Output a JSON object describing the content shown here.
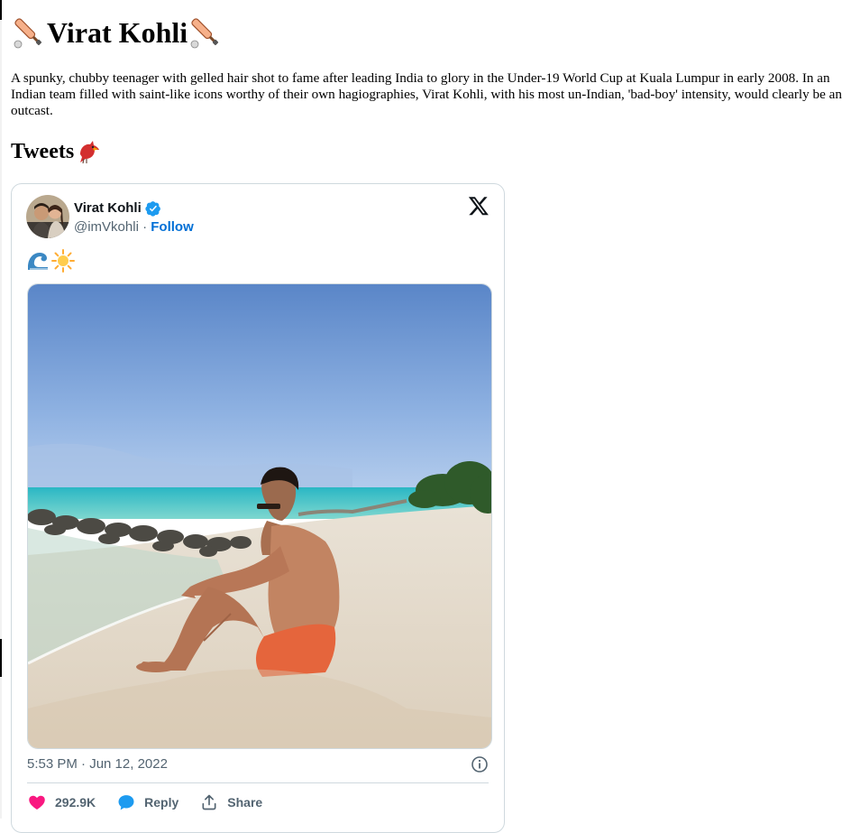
{
  "page": {
    "title": "Virat Kohli",
    "bio": "A spunky, chubby teenager with gelled hair shot to fame after leading India to glory in the Under-19 World Cup at Kuala Lumpur in early 2008. In an Indian team filled with saint-like icons worthy of their own hagiographies, Virat Kohli, with his most un-Indian, 'bad-boy' intensity, would clearly be an outcast.",
    "section_title": "Tweets",
    "title_icon": "cricket-bat-icon",
    "section_icon": "cardinal-bird-icon"
  },
  "tweet": {
    "author_name": "Virat Kohli",
    "handle": "@imVkohli",
    "separator": " · ",
    "follow_label": "Follow",
    "text_emojis": [
      "wave-icon",
      "sun-icon"
    ],
    "timestamp": "5:53 PM · Jun 12, 2022",
    "actions": {
      "likes": "292.9K",
      "reply_label": "Reply",
      "share_label": "Share"
    }
  },
  "colors": {
    "link": "#006fd6",
    "verified": "#1d9bf0",
    "heart": "#f91880",
    "reply": "#1d9bf0",
    "muted": "#536471",
    "border": "#cfd9de"
  }
}
